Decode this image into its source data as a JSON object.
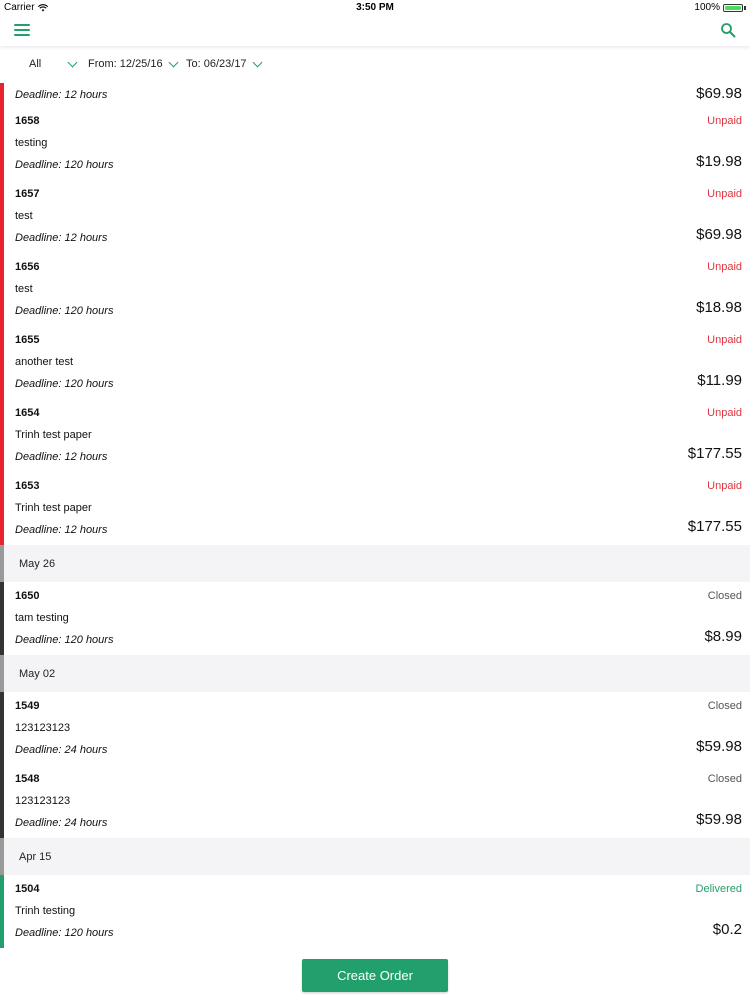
{
  "status_bar": {
    "carrier": "Carrier",
    "time": "3:50 PM",
    "battery": "100%"
  },
  "navbar": {
    "menu_icon": "hamburger-menu-icon",
    "search_icon": "search-icon",
    "accent_color": "#22a06b"
  },
  "filters": {
    "type": "All",
    "from": "From: 12/25/16",
    "to": "To: 06/23/17"
  },
  "orders_top": [
    {
      "id": "",
      "desc": "",
      "deadline": "Deadline: 12 hours",
      "status": "",
      "price": "$69.98"
    },
    {
      "id": "1658",
      "desc": "testing",
      "deadline": "Deadline: 120 hours",
      "status": "Unpaid",
      "price": "$19.98"
    },
    {
      "id": "1657",
      "desc": "test",
      "deadline": "Deadline: 12 hours",
      "status": "Unpaid",
      "price": "$69.98"
    },
    {
      "id": "1656",
      "desc": "test",
      "deadline": "Deadline: 120 hours",
      "status": "Unpaid",
      "price": "$18.98"
    },
    {
      "id": "1655",
      "desc": "another test",
      "deadline": "Deadline: 120 hours",
      "status": "Unpaid",
      "price": "$11.99"
    },
    {
      "id": "1654",
      "desc": "Trinh test paper",
      "deadline": "Deadline: 12 hours",
      "status": "Unpaid",
      "price": "$177.55"
    },
    {
      "id": "1653",
      "desc": "Trinh test paper",
      "deadline": "Deadline: 12 hours",
      "status": "Unpaid",
      "price": "$177.55"
    }
  ],
  "sections": [
    {
      "label": "May 26",
      "orders": [
        {
          "id": "1650",
          "desc": "tam testing",
          "deadline": "Deadline: 120 hours",
          "status": "Closed",
          "price": "$8.99"
        }
      ]
    },
    {
      "label": "May 02",
      "orders": [
        {
          "id": "1549",
          "desc": "123123123",
          "deadline": "Deadline: 24 hours",
          "status": "Closed",
          "price": "$59.98"
        },
        {
          "id": "1548",
          "desc": "123123123",
          "deadline": "Deadline: 24 hours",
          "status": "Closed",
          "price": "$59.98"
        }
      ]
    },
    {
      "label": "Apr 15",
      "orders": [
        {
          "id": "1504",
          "desc": "Trinh testing",
          "deadline": "Deadline: 120 hours",
          "status": "Delivered",
          "price": "$0.2"
        }
      ]
    }
  ],
  "create_button": "Create Order",
  "colors": {
    "unpaid": "#e0353f",
    "closed": "#333333",
    "delivered": "#22a06b"
  }
}
